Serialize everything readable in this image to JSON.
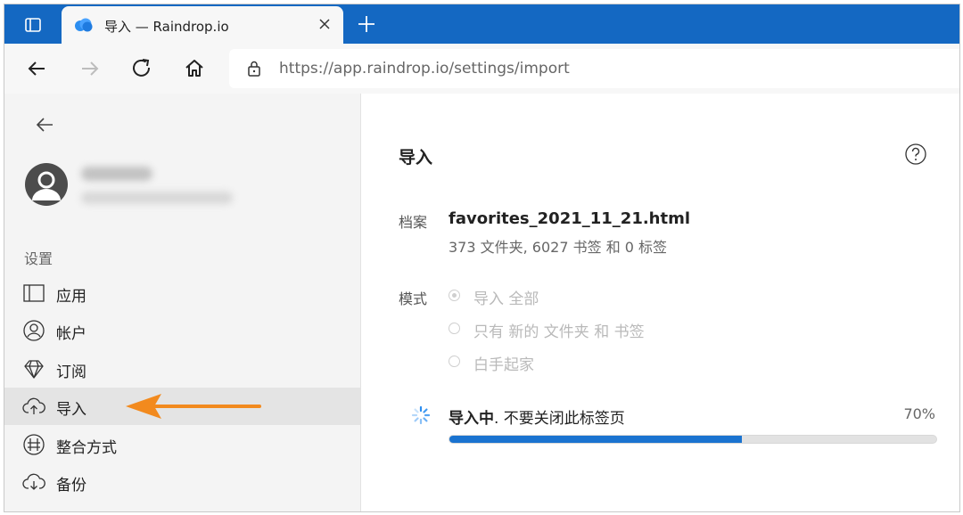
{
  "browser": {
    "tab_title": "导入 — Raindrop.io",
    "url_host": "https://app.raindrop.io",
    "url_path": "/settings/import"
  },
  "sidebar": {
    "section_label": "设置",
    "items": [
      {
        "label": "应用",
        "icon": "app-panel-icon",
        "active": false
      },
      {
        "label": "帐户",
        "icon": "account-icon",
        "active": false
      },
      {
        "label": "订阅",
        "icon": "diamond-icon",
        "active": false
      },
      {
        "label": "导入",
        "icon": "cloud-upload-icon",
        "active": true
      },
      {
        "label": "整合方式",
        "icon": "integrations-icon",
        "active": false
      },
      {
        "label": "备份",
        "icon": "cloud-download-icon",
        "active": false
      }
    ]
  },
  "main": {
    "title": "导入",
    "file_label": "档案",
    "file_name": "favorites_2021_11_21.html",
    "file_stats": "373 文件夹, 6027 书签 和 0 标签",
    "mode_label": "模式",
    "mode_options": [
      {
        "label": "导入 全部",
        "selected": true
      },
      {
        "label": "只有 新的 文件夹 和 书签",
        "selected": false
      },
      {
        "label": "白手起家",
        "selected": false
      }
    ],
    "status_bold": "导入中",
    "status_rest": ". 不要关闭此标签页",
    "progress_percent": "70%",
    "progress_fraction": 0.6
  },
  "colors": {
    "tabbar": "#1468c2",
    "progress": "#1a73d0",
    "annotation_arrow": "#f28a1e"
  }
}
